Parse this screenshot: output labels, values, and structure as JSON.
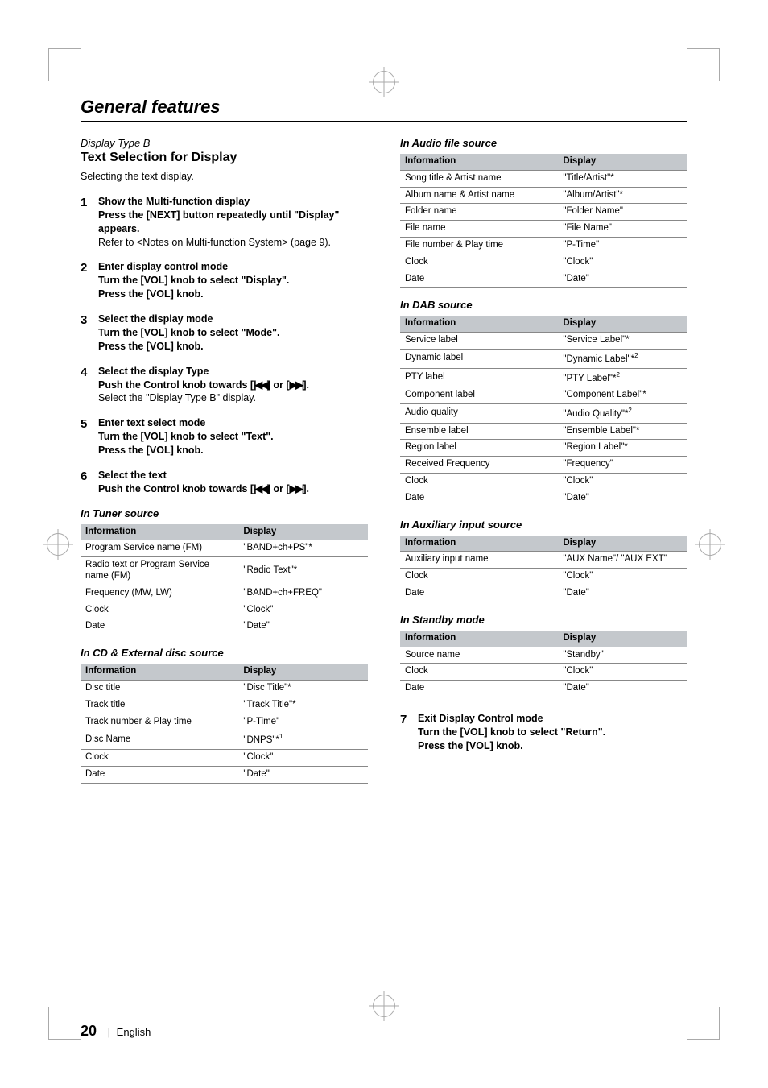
{
  "page": {
    "section_title": "General features",
    "footer": {
      "page_number": "20",
      "separator": "|",
      "language": "English"
    }
  },
  "left": {
    "display_type": "Display Type B",
    "heading": "Text Selection for Display",
    "intro": "Selecting the text display.",
    "steps": {
      "s1": {
        "num": "1",
        "title": "Show the Multi-function display",
        "instr": "Press the [NEXT] button repeatedly until \"Display\" appears.",
        "note": "Refer to <Notes on Multi-function System> (page 9)."
      },
      "s2": {
        "num": "2",
        "title": "Enter display control mode",
        "instr1": "Turn the [VOL] knob to select \"Display\".",
        "instr2": "Press the [VOL] knob."
      },
      "s3": {
        "num": "3",
        "title": "Select the display mode",
        "instr1": "Turn the [VOL] knob to select \"Mode\".",
        "instr2": "Press the [VOL] knob."
      },
      "s4": {
        "num": "4",
        "title": "Select the display Type",
        "instr_pre": "Push the Control knob towards [",
        "instr_mid": "] or [",
        "instr_post": "].",
        "note": "Select the \"Display Type B\" display."
      },
      "s5": {
        "num": "5",
        "title": "Enter text select mode",
        "instr1": "Turn the [VOL] knob to select \"Text\".",
        "instr2": "Press the [VOL] knob."
      },
      "s6": {
        "num": "6",
        "title": "Select the text",
        "instr_pre": "Push the Control knob towards [",
        "instr_mid": "] or [",
        "instr_post": "]."
      }
    },
    "tables": {
      "tuner": {
        "heading": "In Tuner source",
        "col1": "Information",
        "col2": "Display",
        "rows": [
          [
            "Program Service name (FM)",
            "\"BAND+ch+PS\"*"
          ],
          [
            "Radio text or Program Service name (FM)",
            "\"Radio Text\"*"
          ],
          [
            "Frequency (MW, LW)",
            "\"BAND+ch+FREQ\""
          ],
          [
            "Clock",
            "\"Clock\""
          ],
          [
            "Date",
            "\"Date\""
          ]
        ]
      },
      "cd": {
        "heading": "In CD & External disc source",
        "col1": "Information",
        "col2": "Display",
        "rows": [
          [
            "Disc title",
            "\"Disc Title\"*"
          ],
          [
            "Track title",
            "\"Track Title\"*"
          ],
          [
            "Track number & Play time",
            "\"P-Time\""
          ],
          [
            "Disc Name",
            "\"DNPS\"*",
            "1"
          ],
          [
            "Clock",
            "\"Clock\""
          ],
          [
            "Date",
            "\"Date\""
          ]
        ]
      }
    }
  },
  "right": {
    "tables": {
      "audio": {
        "heading": "In Audio file source",
        "col1": "Information",
        "col2": "Display",
        "rows": [
          [
            "Song title & Artist name",
            "\"Title/Artist\"*"
          ],
          [
            "Album name & Artist name",
            "\"Album/Artist\"*"
          ],
          [
            "Folder name",
            "\"Folder Name\""
          ],
          [
            "File name",
            "\"File Name\""
          ],
          [
            "File number & Play time",
            "\"P-Time\""
          ],
          [
            "Clock",
            "\"Clock\""
          ],
          [
            "Date",
            "\"Date\""
          ]
        ]
      },
      "dab": {
        "heading": "In DAB source",
        "col1": "Information",
        "col2": "Display",
        "rows": [
          [
            "Service label",
            "\"Service Label\"*"
          ],
          [
            "Dynamic label",
            "\"Dynamic Label\"*",
            "2"
          ],
          [
            "PTY label",
            "\"PTY Label\"*",
            "2"
          ],
          [
            "Component label",
            "\"Component Label\"*"
          ],
          [
            "Audio quality",
            "\"Audio Quality\"*",
            "2"
          ],
          [
            "Ensemble label",
            "\"Ensemble Label\"*"
          ],
          [
            "Region label",
            "\"Region Label\"*"
          ],
          [
            "Received Frequency",
            "\"Frequency\""
          ],
          [
            "Clock",
            "\"Clock\""
          ],
          [
            "Date",
            "\"Date\""
          ]
        ]
      },
      "aux": {
        "heading": "In Auxiliary input source",
        "col1": "Information",
        "col2": "Display",
        "rows": [
          [
            "Auxiliary input name",
            "\"AUX Name\"/ \"AUX EXT\""
          ],
          [
            "Clock",
            "\"Clock\""
          ],
          [
            "Date",
            "\"Date\""
          ]
        ]
      },
      "standby": {
        "heading": "In Standby mode",
        "col1": "Information",
        "col2": "Display",
        "rows": [
          [
            "Source name",
            "\"Standby\""
          ],
          [
            "Clock",
            "\"Clock\""
          ],
          [
            "Date",
            "\"Date\""
          ]
        ]
      }
    },
    "step7": {
      "num": "7",
      "title": "Exit Display Control mode",
      "instr1": "Turn the [VOL] knob to select \"Return\".",
      "instr2": "Press the [VOL] knob."
    }
  },
  "icons": {
    "rewind": "|◀◀",
    "ffwd": "▶▶|"
  }
}
